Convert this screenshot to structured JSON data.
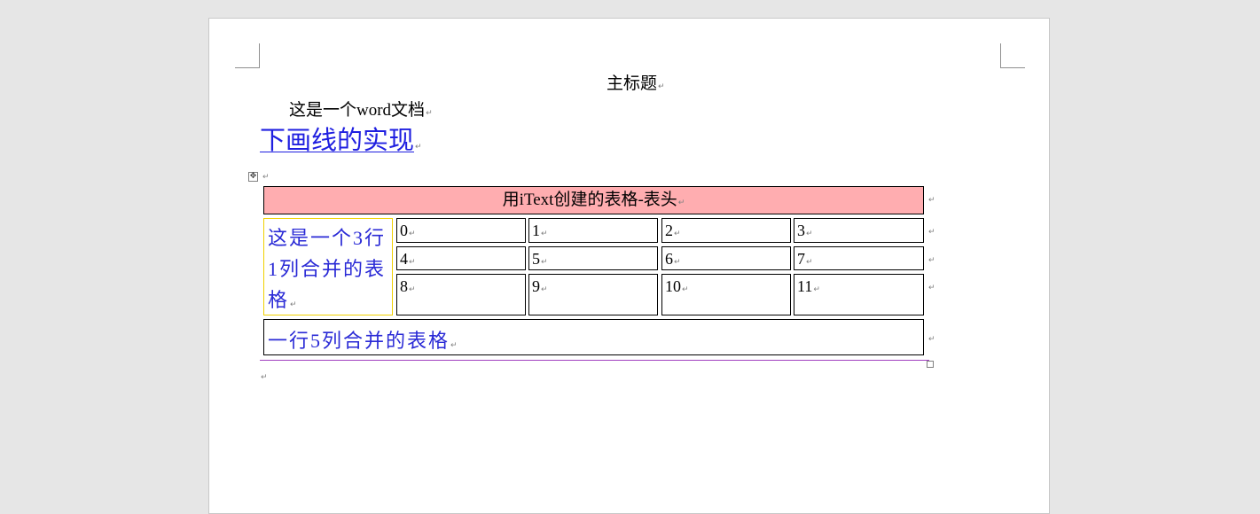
{
  "document": {
    "title": "主标题",
    "paragraph": "这是一个word文档",
    "heading": "下画线的实现",
    "paragraph_mark": "↵",
    "table_move_handle": "move-arrows-icon"
  },
  "table": {
    "header": "用iText创建的表格-表头",
    "merged_3_rows": "这是一个3行1列合并的表格",
    "cells": [
      "0",
      "1",
      "2",
      "3",
      "4",
      "5",
      "6",
      "7",
      "8",
      "9",
      "10",
      "11"
    ],
    "merged_5_cols": "一行5列合并的表格",
    "header_bg": "#ffadb0",
    "merged_text_color": "#2a2ad6",
    "merged_3_border": "#f0d000"
  }
}
